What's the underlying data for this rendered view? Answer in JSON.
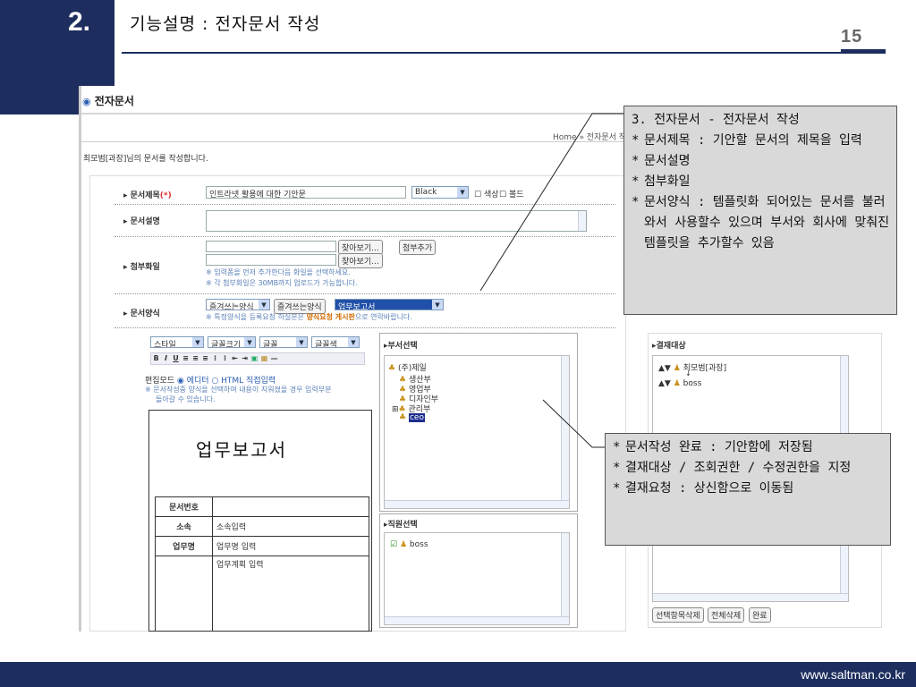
{
  "slide": {
    "section_number": "2.",
    "title": "기능설명 : 전자문서 작성",
    "page_number": "15",
    "footer_url": "www.saltman.co.kr"
  },
  "screen": {
    "header_title": "전자문서",
    "breadcrumb": "Home » 전자문서 작성",
    "user_notice": "최모범[과장]님의 문서를 작성합니다.",
    "form": {
      "doc_title_label": "문서제목",
      "doc_title_required": "(*)",
      "doc_title_value": "인트라넷 활용에 대한 기안문",
      "color_select": "Black",
      "color_chk_label": "색상",
      "bold_chk_label": "볼드",
      "desc_label": "문서설명",
      "attach_label": "첨부화일",
      "browse_btn_1": "찾아보기...",
      "browse_btn_2": "찾아보기...",
      "add_attach_btn": "첨부추가",
      "attach_note_1": "※ 입력폼을 먼저 추가한다음 화일을 선택하세요.",
      "attach_note_2": "※ 각 첨부화일은 30MB까지 업로드가 가능합니다.",
      "template_label": "문서양식",
      "fav_template_select": "즐겨쓰는양식",
      "fav_template_btn": "즐겨쓰는양식",
      "template_select": "업무보고서",
      "template_note_prefix": "※ 특정양식을 등록요청 하실분은 ",
      "template_note_link": "양식요청 게시판",
      "template_note_suffix": "으로 연락바랍니다."
    },
    "editor": {
      "style_select": "스타일",
      "size_select": "글꼴크기",
      "font_select": "글꼴",
      "color_select": "글꼴색",
      "mode_label": "편집모드",
      "mode_editor": "에디터",
      "mode_html": "HTML 직접입력",
      "warning_1": "※ 문서작성중 양식을 선택하여 내용이 지워졌을 경우 입력부분",
      "warning_2": "돌아갈 수 있습니다."
    },
    "document": {
      "heading": "업무보고서",
      "rows": [
        {
          "label": "문서번호",
          "value": ""
        },
        {
          "label": "소속",
          "value": "소속입력"
        },
        {
          "label": "업무명",
          "value": "업무명 입력"
        }
      ],
      "plan_text": "업무계획 입력"
    },
    "dept_panel": {
      "title": "부서선택",
      "root": "(주)제일",
      "items": [
        "생산부",
        "영업부",
        "디자인부",
        "관리부",
        "ceo"
      ]
    },
    "staff_panel": {
      "title": "직원선택",
      "items": [
        "boss"
      ]
    },
    "approval_panel": {
      "title": "결재대상",
      "items": [
        "최모범[과장]",
        "boss"
      ],
      "buttons": [
        "선택항목삭제",
        "전체삭제",
        "완료"
      ]
    }
  },
  "callout_top": {
    "heading": "3. 전자문서 - 전자문서 작성",
    "bullets": [
      "문서제목 : 기안할 문서의 제목을 입력",
      "문서설명",
      "첨부화일",
      "문서양식 : 템플릿화 되어있는 문서를 불러와서 사용할수 있으며 부서와 회사에 맞춰진 템플릿을 추가할수 있음"
    ]
  },
  "callout_bottom": {
    "bullets": [
      "문서작성 완료 : 기안함에 저장됨",
      "결재대상 / 조회권한 / 수정권한을 지정",
      "결재요청 : 상신함으로 이동됨"
    ]
  }
}
